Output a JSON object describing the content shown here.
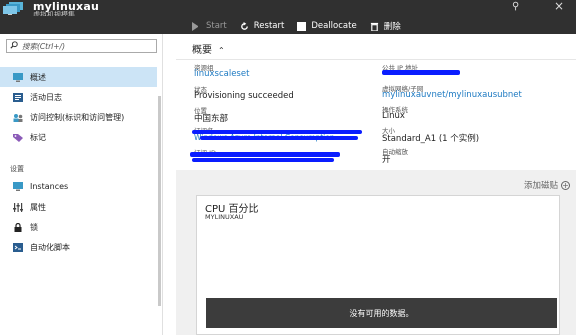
{
  "window": {
    "title": "mylinuxau",
    "subtitle": "虚拟机规模集",
    "pin_icon": "pin-icon",
    "close_icon": "close-icon"
  },
  "toolbar": {
    "start_label": "Start",
    "restart_label": "Restart",
    "deallocate_label": "Deallocate",
    "delete_label": "删除"
  },
  "search": {
    "placeholder": "搜索(Ctrl+/)"
  },
  "sidebar": {
    "items": [
      {
        "label": "概述",
        "icon": "overview-icon"
      },
      {
        "label": "活动日志",
        "icon": "activity-log-icon"
      },
      {
        "label": "访问控制(标识和访问管理)",
        "icon": "access-control-icon"
      },
      {
        "label": "标记",
        "icon": "tag-icon"
      }
    ],
    "section_label": "设置",
    "settings_items": [
      {
        "label": "Instances",
        "icon": "instances-icon"
      },
      {
        "label": "属性",
        "icon": "properties-icon"
      },
      {
        "label": "锁",
        "icon": "lock-icon"
      },
      {
        "label": "自动化脚本",
        "icon": "automation-script-icon"
      }
    ]
  },
  "essentials": {
    "header": "概要",
    "resource_group_label": "资源组",
    "resource_group_value": "linuxscaleset",
    "status_label": "状态",
    "status_value": "Provisioning succeeded",
    "location_label": "位置",
    "location_value": "中国东部",
    "subscription_label": "订阅名",
    "subscription_value": "Windows Azure Internal Consumption",
    "subscription_id_label": "订阅 ID",
    "public_ip_label": "公共 IP 地址",
    "vnet_label": "虚拟网络/子网",
    "vnet_value": "mylinuxauvnet/mylinuxausubnet",
    "os_label": "操作系统",
    "os_value": "Linux",
    "size_label": "大小",
    "size_value": "Standard_A1 (1 个实例)",
    "autoscale_label": "自动缩放",
    "autoscale_value": "开"
  },
  "tiles": {
    "add_tile_label": "添加磁贴",
    "cpu_title": "CPU 百分比",
    "cpu_subtitle": "MYLINUXAU",
    "no_data": "没有可用的数据。"
  },
  "colors": {
    "titlebar_bg": "#303030",
    "selected_bg": "#cce4f6",
    "link": "#1e7ac2",
    "redaction": "#0a1dff",
    "nodata_bg": "#3c3c3c"
  }
}
